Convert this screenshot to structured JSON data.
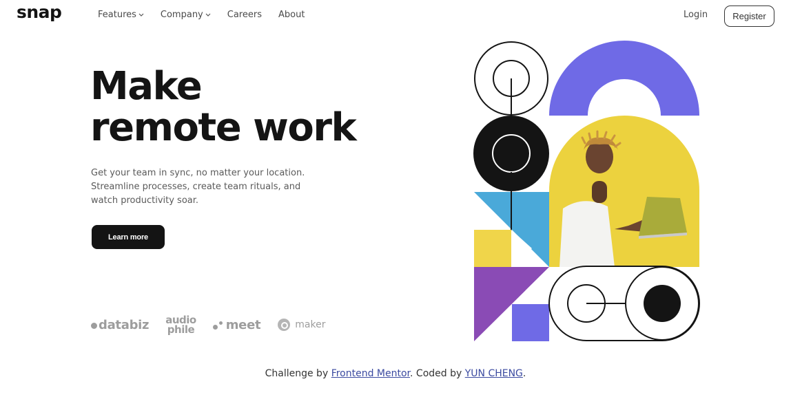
{
  "header": {
    "logo": "snap",
    "nav": [
      {
        "label": "Features",
        "has_dropdown": true
      },
      {
        "label": "Company",
        "has_dropdown": true
      },
      {
        "label": "Careers",
        "has_dropdown": false
      },
      {
        "label": "About",
        "has_dropdown": false
      }
    ],
    "login_label": "Login",
    "register_label": "Register"
  },
  "hero": {
    "title_line1": "Make",
    "title_line2": "remote work",
    "description": "Get your team in sync, no matter your location. Streamline processes, create team rituals, and watch productivity soar.",
    "cta_label": "Learn more"
  },
  "clients": {
    "databiz": "databiz",
    "audiophile_top": "audio",
    "audiophile_bottom": "phile",
    "meet": "meet",
    "maker": "maker"
  },
  "colors": {
    "accent_purple": "#6f6ae6",
    "yellow": "#e8d23a",
    "blue": "#4aa9d9",
    "violet": "#8a4bb5",
    "dark": "#141414"
  },
  "footer": {
    "prefix": "Challenge by ",
    "link1": "Frontend Mentor",
    "middle": ". Coded by ",
    "link2": "YUN CHENG",
    "suffix": "."
  }
}
